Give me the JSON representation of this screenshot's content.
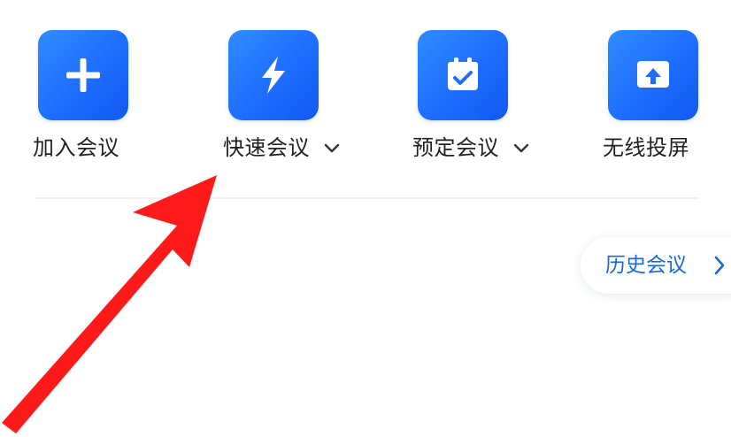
{
  "actions": [
    {
      "label": "加入会议",
      "icon": "plus-icon",
      "has_dropdown": false
    },
    {
      "label": "快速会议",
      "icon": "lightning-icon",
      "has_dropdown": true
    },
    {
      "label": "预定会议",
      "icon": "calendar-check-icon",
      "has_dropdown": true
    },
    {
      "label": "无线投屏",
      "icon": "screen-cast-icon",
      "has_dropdown": false
    }
  ],
  "history": {
    "label": "历史会议",
    "icon": "chevron-right-icon"
  },
  "annotation": {
    "icon": "red-arrow-icon",
    "color": "#ff1a1a"
  },
  "colors": {
    "tile": "#1e6dff",
    "link": "#1a66e0",
    "text": "#222222"
  }
}
